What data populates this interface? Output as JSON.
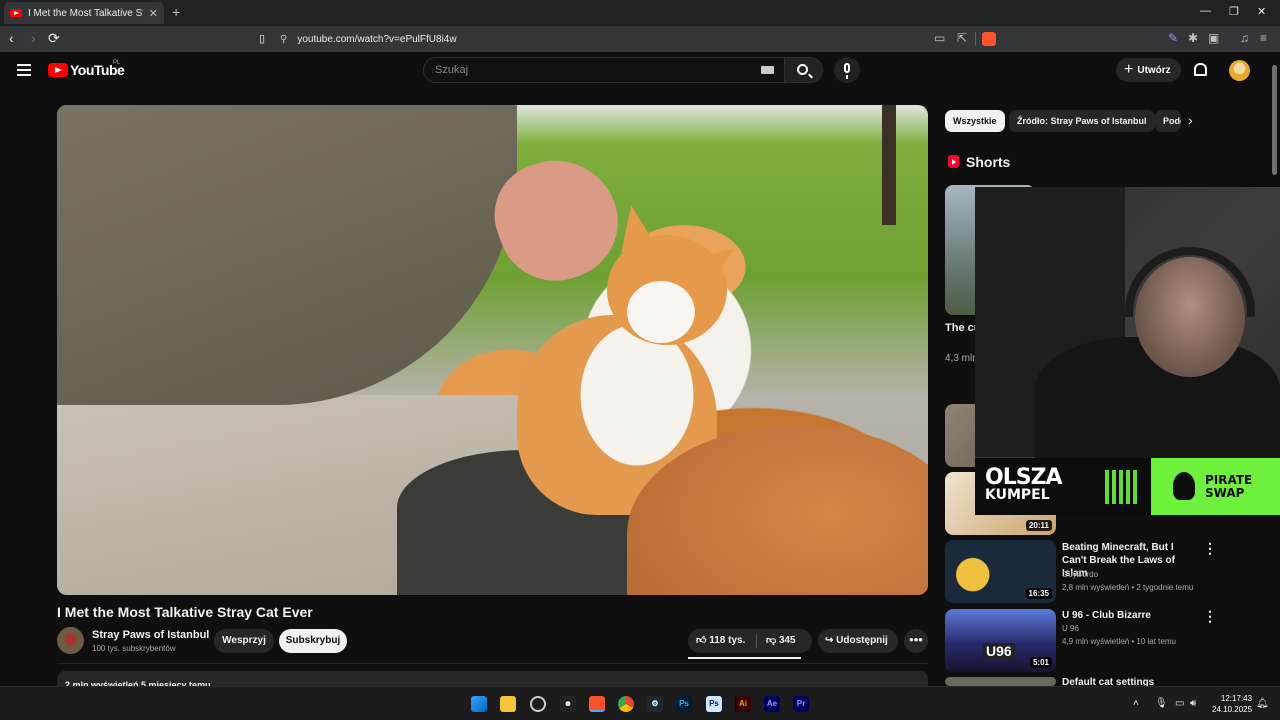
{
  "browser": {
    "tab_title": "I Met the Most Talkative Stray Cat Ever - YouTube",
    "tab_close": "✕",
    "new_tab": "+",
    "url": "youtube.com/watch?v=ePulFfU8i4w",
    "window_controls": {
      "minimize": "—",
      "maximize": "❐",
      "close": "✕"
    }
  },
  "youtube": {
    "logo_text": "YouTube",
    "country": "PL",
    "search_placeholder": "Szukaj",
    "create_label": "Utwórz"
  },
  "video": {
    "title": "I Met the Most Talkative Stray Cat Ever",
    "channel": "Stray Paws of Istanbul",
    "subscribers": "100 tys. subskrybentów",
    "join_label": "Wesprzyj",
    "subscribe_label": "Subskrybuj",
    "likes": "118 tys.",
    "dislikes": "345",
    "share_label": "Udostępnij",
    "more_label": "•••",
    "description_meta": "2 mln wyświetleń  5 miesięcy temu"
  },
  "filters": {
    "chips": [
      "Wszystkie",
      "Źródło: Stray Paws of Istanbul",
      "Podobne"
    ],
    "next": "›"
  },
  "shorts": {
    "heading": "Shorts",
    "item": {
      "title": "The cute street",
      "views": "4,3 mln wyświetleń"
    }
  },
  "overlay": {
    "sponsor1_line1": "OLSZA",
    "sponsor1_line2": "KUMPEL",
    "sponsor2_line1": "PIRATE",
    "sponsor2_line2": "SWAP"
  },
  "recommendations": [
    {
      "duration": "20:11"
    },
    {
      "title": "Beating Minecraft, But I Can't Break the Laws of Islam",
      "channel": "GuyBordo",
      "meta": "2,8 mln wyświetleń • 2 tygodnie temu",
      "duration": "16:35"
    },
    {
      "title": "U 96 - Club Bizarre",
      "channel": "U 96",
      "meta": "4,9 mln wyświetleń • 10 lat temu",
      "duration": "5:01",
      "thumb_text": "U96"
    },
    {
      "title": "Default cat settings"
    }
  ],
  "taskbar": {
    "apps": [
      "Ps",
      "Ps",
      "Ai",
      "Ae",
      "Pr"
    ],
    "time": "12:17:43",
    "date": "24.10.2025"
  },
  "colors": {
    "youtube_red": "#ff0000",
    "bg": "#0f0f0f",
    "chip_active": "#f1f1f1",
    "pirate_green": "#6ef03c"
  }
}
